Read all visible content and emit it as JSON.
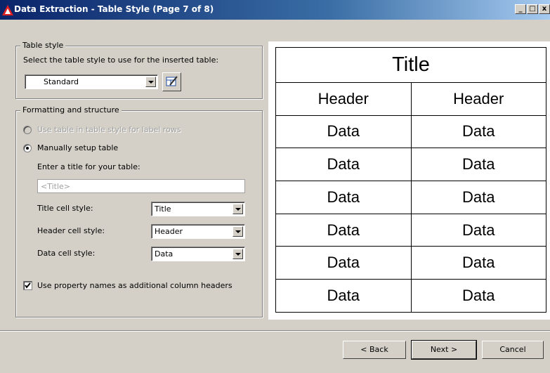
{
  "window": {
    "title": "Data Extraction - Table Style (Page 7 of 8)",
    "controls": {
      "minimize": "_",
      "maximize": "□",
      "close": "x"
    }
  },
  "table_style": {
    "legend": "Table style",
    "instruction": "Select the table style to use for the inserted table:",
    "selected": "Standard"
  },
  "formatting": {
    "legend": "Formatting and structure",
    "option_label_rows": "Use table in table style for label rows",
    "option_manual": "Manually setup table",
    "title_prompt": "Enter a title for your table:",
    "title_placeholder": "<Title>",
    "title_cell_label": "Title cell style:",
    "title_cell_value": "Title",
    "header_cell_label": "Header cell style:",
    "header_cell_value": "Header",
    "data_cell_label": "Data cell style:",
    "data_cell_value": "Data",
    "use_property_names": "Use property names as additional column headers",
    "manual_selected": true,
    "use_property_names_checked": true
  },
  "preview": {
    "title": "Title",
    "headers": [
      "Header",
      "Header"
    ],
    "rows": [
      [
        "Data",
        "Data"
      ],
      [
        "Data",
        "Data"
      ],
      [
        "Data",
        "Data"
      ],
      [
        "Data",
        "Data"
      ],
      [
        "Data",
        "Data"
      ],
      [
        "Data",
        "Data"
      ]
    ]
  },
  "buttons": {
    "back": "< Back",
    "next": "Next >",
    "cancel": "Cancel"
  },
  "colors": {
    "titlebar_start": "#0a246a",
    "titlebar_end": "#a6caf0",
    "dialog_bg": "#d4d0c8"
  }
}
